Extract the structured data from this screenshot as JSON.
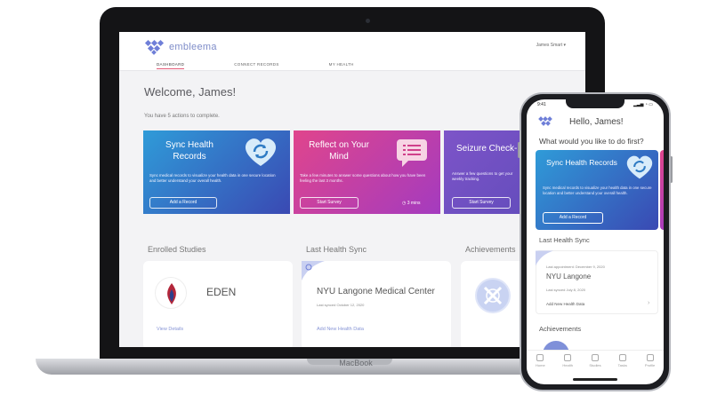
{
  "laptop": {
    "brand": "MacBook",
    "app": {
      "logo_text": "embleema",
      "user_menu": "James Smart ▾",
      "nav": [
        "DASHBOARD",
        "CONNECT RECORDS",
        "MY HEALTH"
      ],
      "welcome": "Welcome, James!",
      "actions_text": "You have 5 actions to complete.",
      "cards": [
        {
          "title": "Sync Health Records",
          "desc": "Sync medical records to visualize your health data in one secure location and better understand your overall health.",
          "button": "Add a Record",
          "icon": "heart-sync-icon"
        },
        {
          "title": "Reflect on Your Mind",
          "desc": "Take a few minutes to answer some questions about how you have been feeling the last 3 months.",
          "button": "Start Survey",
          "meta": "3 mins",
          "icon": "chat-bubble-icon"
        },
        {
          "title": "Seizure Check-In",
          "desc": "Answer a few questions to get your weekly tracking.",
          "button": "Start Survey"
        }
      ],
      "sections": {
        "enrolled": {
          "label": "Enrolled Studies",
          "study": "EDEN",
          "link": "View Details"
        },
        "sync": {
          "label": "Last Health Sync",
          "title": "NYU Langone Medical Center",
          "sub": "Last synced October 12, 2020",
          "link": "Add New Health Data"
        },
        "achievements": {
          "label": "Achievements"
        }
      }
    }
  },
  "phone": {
    "time": "9:41",
    "status_right": "▂▃▅ ◔ ▭",
    "hello": "Hello, James!",
    "question": "What would you like to do first?",
    "card": {
      "title": "Sync Health Records",
      "desc": "Sync medical records to visualize your health data in one secure location and better understand your overall health.",
      "button": "Add a Record"
    },
    "sync_label": "Last Health Sync",
    "last_appointment": "Last appointment: December 9, 2020",
    "clinic": "NYU Langone",
    "last_synced": "Last synced July 8, 2020",
    "add_data": "Add New Health Data",
    "chevron": "›",
    "achievements_label": "Achievements",
    "tabs": [
      "Home",
      "Health",
      "Studies",
      "Tasks",
      "Profile"
    ]
  },
  "colors": {
    "accent": "#6f7fd8",
    "card_blue_start": "#2f9bd8",
    "card_blue_end": "#3a49b3",
    "card_pink_start": "#e0458c",
    "card_purple_end": "#a43bbf",
    "nav_active_underline": "#e35a78"
  }
}
